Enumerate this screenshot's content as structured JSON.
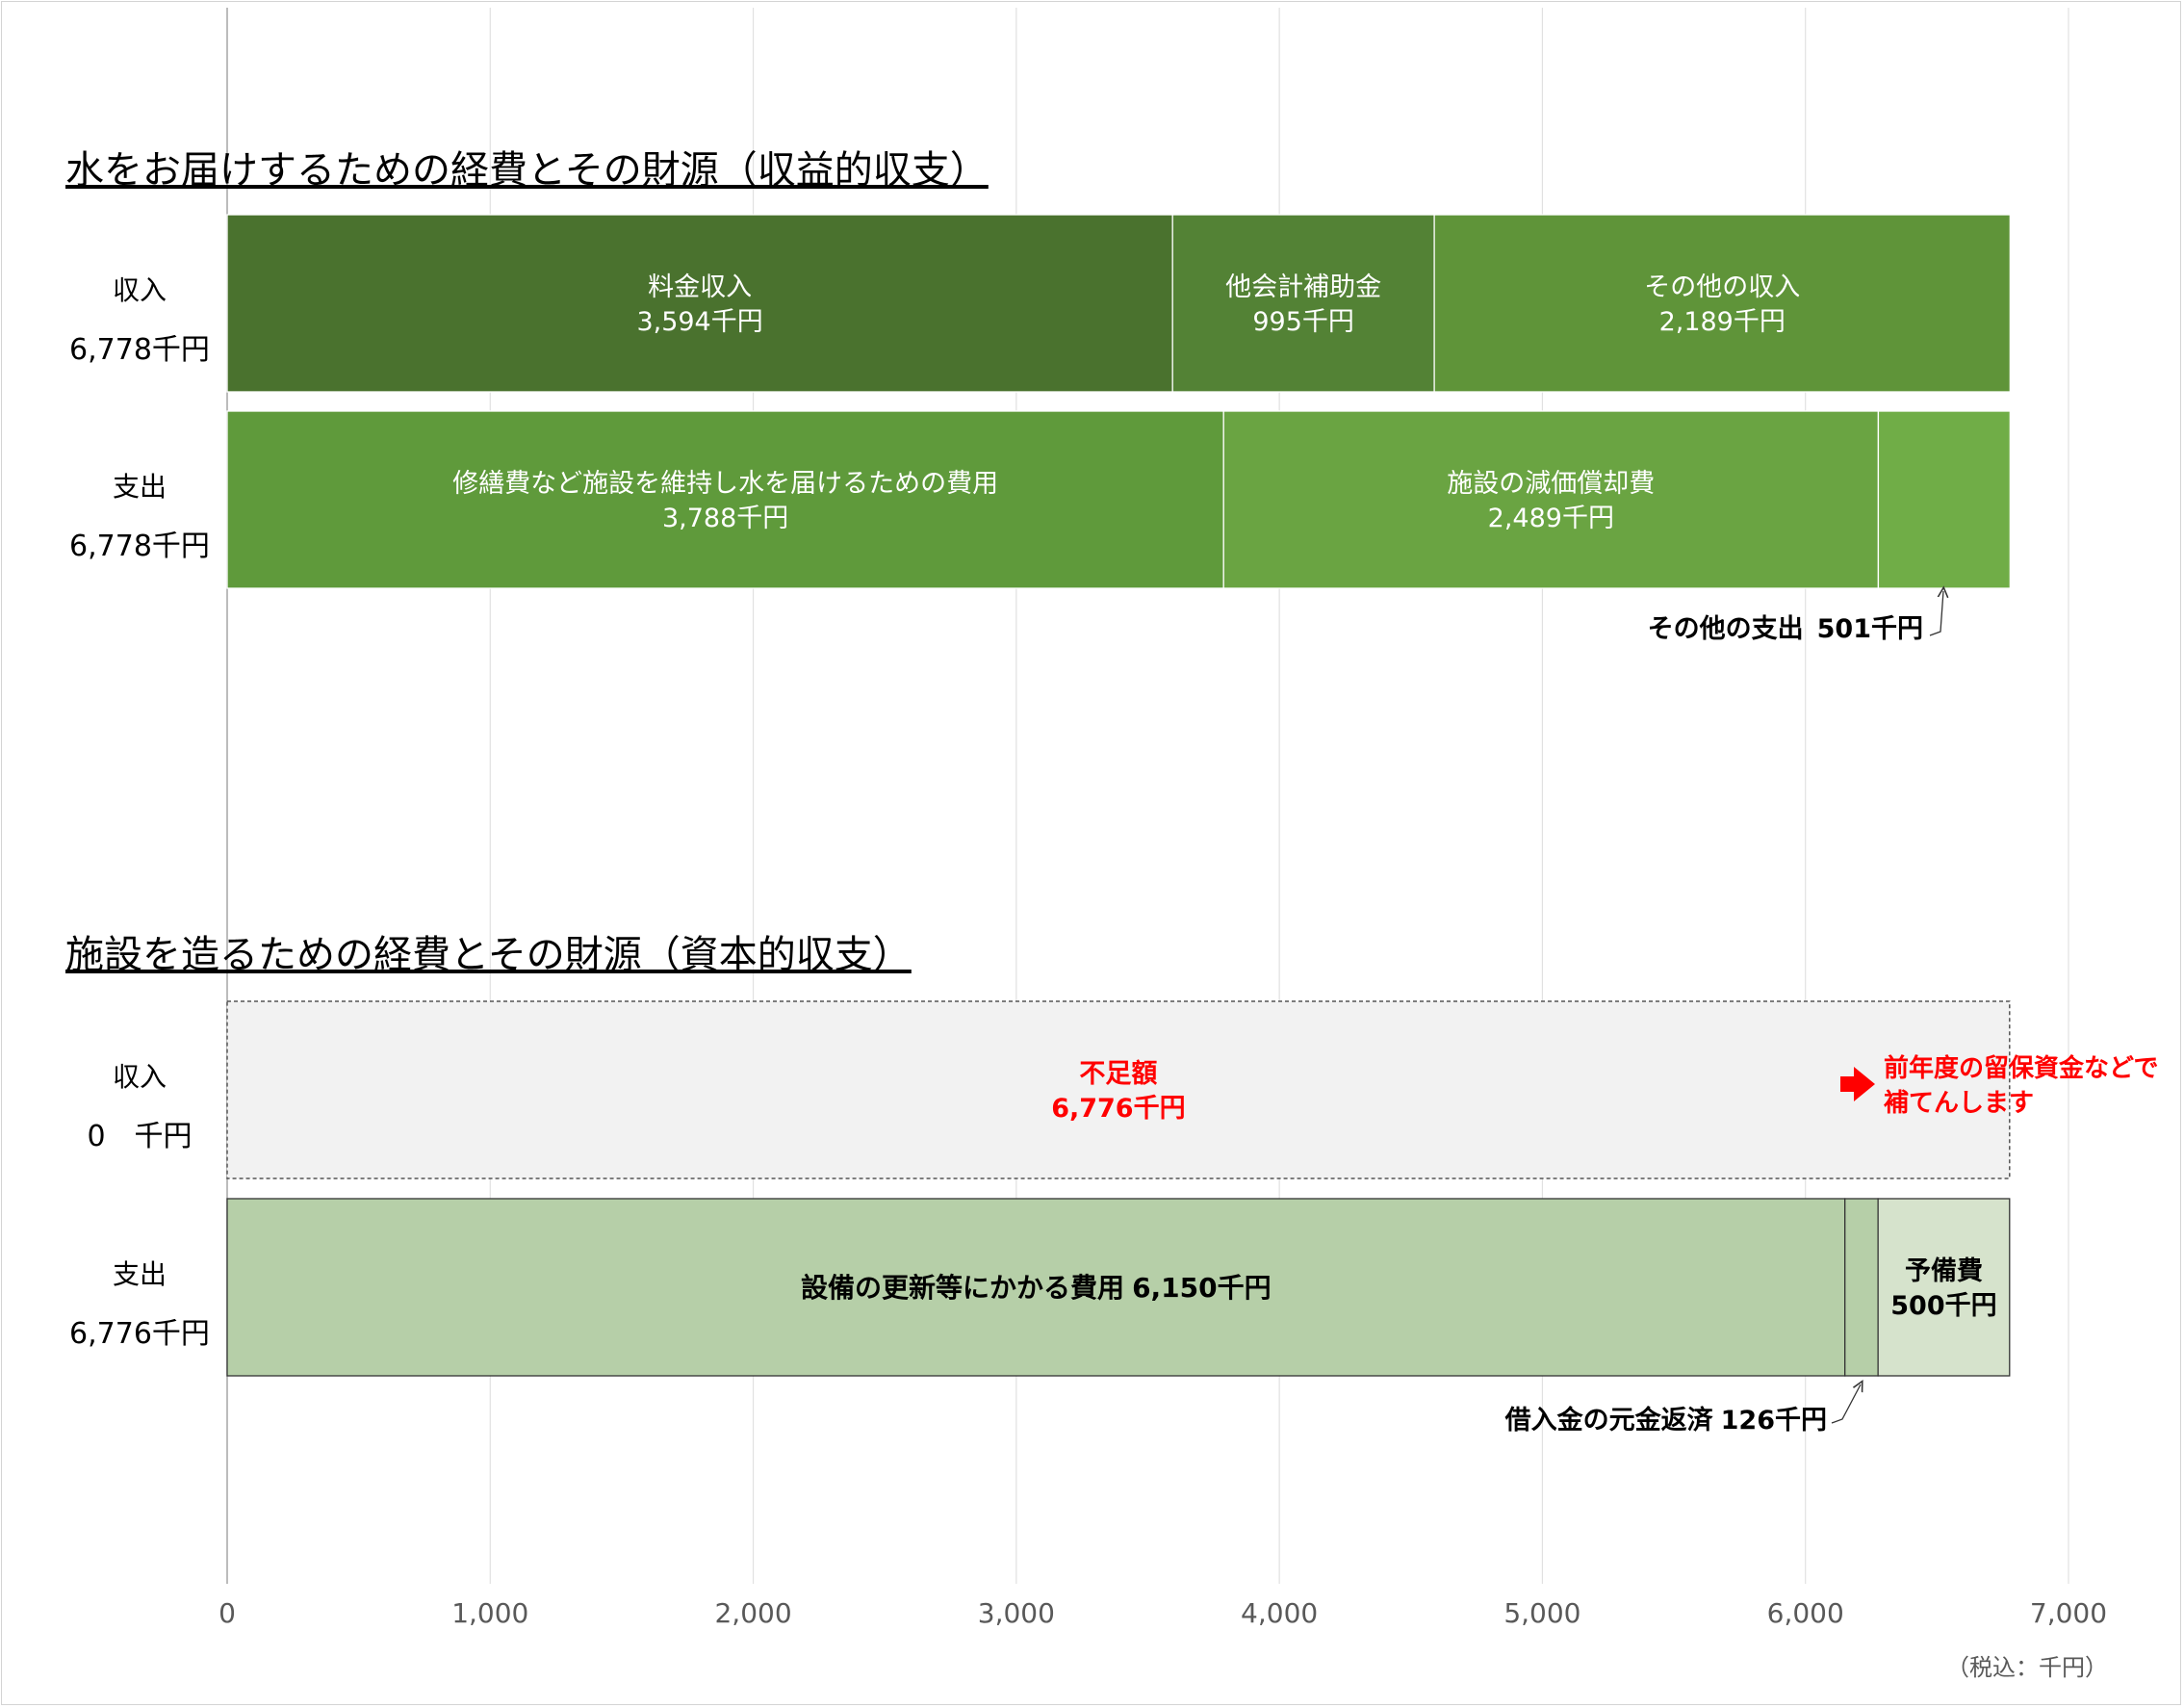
{
  "chart_data": {
    "type": "bar",
    "orientation": "horizontal-stacked",
    "xlim": [
      0,
      7000
    ],
    "x_ticks": [
      "0",
      "1,000",
      "2,000",
      "3,000",
      "4,000",
      "5,000",
      "6,000",
      "7,000"
    ],
    "x_tick_values": [
      0,
      1000,
      2000,
      3000,
      4000,
      5000,
      6000,
      7000
    ],
    "grid": true,
    "unit_note": "（税込：千円）",
    "sections": [
      {
        "title": "水をお届けするための経費とその財源（収益的収支）",
        "rows": [
          {
            "label": "収入",
            "total_label": "6,778千円",
            "segments": [
              {
                "name": "料金収入",
                "value": 3594,
                "value_label": "3,594千円",
                "color": "#4a722e",
                "text_color": "#ffffff"
              },
              {
                "name": "他会計補助金",
                "value": 995,
                "value_label": "995千円",
                "color": "#538235",
                "text_color": "#ffffff"
              },
              {
                "name": "その他の収入",
                "value": 2189,
                "value_label": "2,189千円",
                "color": "#5f9439",
                "text_color": "#ffffff"
              }
            ]
          },
          {
            "label": "支出",
            "total_label": "6,778千円",
            "segments": [
              {
                "name": "修繕費など施設を維持し水を届けるための費用",
                "value": 3788,
                "value_label": "3,788千円",
                "color": "#5f9a3b",
                "text_color": "#ffffff"
              },
              {
                "name": "施設の減価償却費",
                "value": 2489,
                "value_label": "2,489千円",
                "color": "#6aa442",
                "text_color": "#ffffff"
              },
              {
                "name": "",
                "value": 501,
                "value_label": "",
                "color": "#70ad47",
                "text_color": "#ffffff"
              }
            ],
            "callout": {
              "name": "その他の支出",
              "value_label": "501千円"
            }
          }
        ]
      },
      {
        "title": "施設を造るための経費とその財源（資本的収支）",
        "rows": [
          {
            "label": "収入",
            "total_label": "0　千円",
            "segments": [
              {
                "name": "不足額",
                "value": 6776,
                "value_label": "6,776千円",
                "color": "#f2f2f2",
                "text_color": "#ff0000",
                "dashed": true
              }
            ],
            "note_lines": [
              "前年度の留保資金などで",
              "補てんします"
            ],
            "note_color": "#ff0000"
          },
          {
            "label": "支出",
            "total_label": "6,776千円",
            "segments": [
              {
                "name": "設備の更新等にかかる費用",
                "value": 6150,
                "value_label": "6,150千円",
                "color": "#b6cfa8",
                "text_color": "#000000"
              },
              {
                "name": "",
                "value": 126,
                "value_label": "",
                "color": "#b6cfa8",
                "text_color": "#000000"
              },
              {
                "name": "予備費",
                "value": 500,
                "value_label": "500千円",
                "color": "#d6e3cc",
                "text_color": "#000000"
              }
            ],
            "callout": {
              "name": "借入金の元金返済",
              "value_label": "126千円"
            }
          }
        ]
      }
    ]
  }
}
